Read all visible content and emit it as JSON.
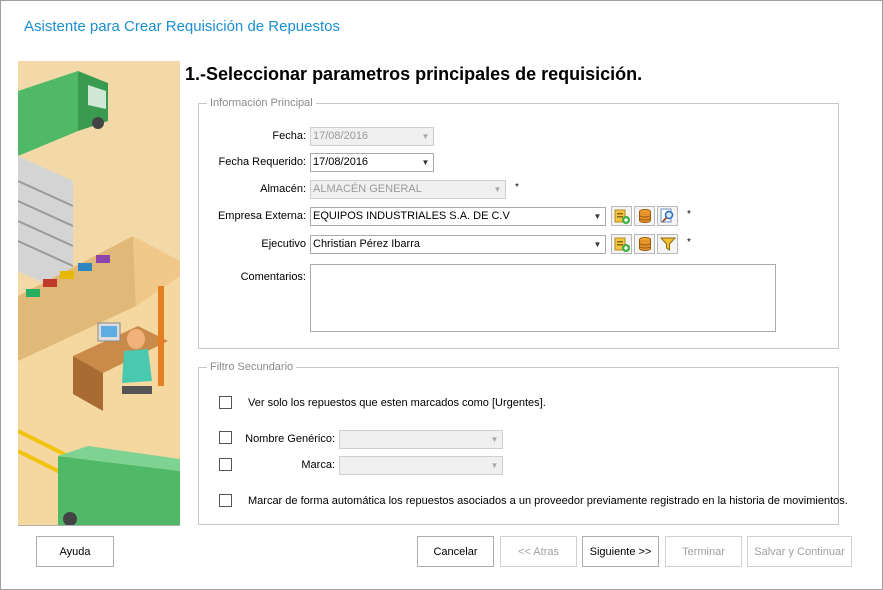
{
  "window": {
    "title": "Asistente para Crear Requisición de Repuestos"
  },
  "step_title": "1.-Seleccionar parametros principales de requisición.",
  "principal": {
    "legend": "Información Principal",
    "fecha": {
      "label": "Fecha:",
      "value": "17/08/2016",
      "enabled": false
    },
    "fecha_requerido": {
      "label": "Fecha Requerido:",
      "value": "17/08/2016",
      "enabled": true
    },
    "almacen": {
      "label": "Almacén:",
      "value": "ALMACÉN GENERAL",
      "enabled": false,
      "required_mark": "*"
    },
    "empresa_externa": {
      "label": "Empresa Externa:",
      "value": "EQUIPOS INDUSTRIALES S.A. DE C.V",
      "required_mark": "*"
    },
    "ejecutivo": {
      "label": "Ejecutivo",
      "value": "Christian Pérez Ibarra",
      "required_mark": "*"
    },
    "comentarios": {
      "label": "Comentarios:",
      "value": ""
    }
  },
  "secundario": {
    "legend": "Filtro Secundario",
    "urgentes": {
      "label": "Ver solo los repuestos que esten marcados como [Urgentes].",
      "checked": false
    },
    "nombre_generico": {
      "label": "Nombre Genérico:",
      "checked": false,
      "value": ""
    },
    "marca": {
      "label": "Marca:",
      "checked": false,
      "value": ""
    },
    "auto_marcar": {
      "label": "Marcar de forma automática los repuestos asociados a un proveedor previamente registrado en la historia de movimientos.",
      "checked": false
    }
  },
  "buttons": {
    "ayuda": "Ayuda",
    "cancelar": "Cancelar",
    "atras": "<< Atras",
    "siguiente": "Siguiente >>",
    "terminar": "Terminar",
    "salvar": "Salvar y Continuar"
  },
  "icons": {
    "add": "add-record-icon",
    "database": "database-icon",
    "search": "search-icon",
    "filter": "filter-icon"
  },
  "colors": {
    "title": "#1b8fd1"
  }
}
